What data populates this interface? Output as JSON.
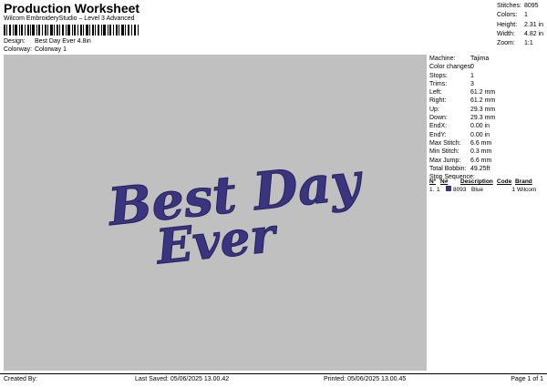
{
  "header": {
    "title": "Production Worksheet",
    "subtitle": "Wilcom EmbroideryStudio – Level 3 Advanced",
    "design_label": "Design:",
    "design_value": "Best Day Ever 4.8in",
    "colorway_label": "Colorway:",
    "colorway_value": "Colorway 1"
  },
  "stats": [
    {
      "label": "Stitches:",
      "value": "8095"
    },
    {
      "label": "Colors:",
      "value": "1"
    },
    {
      "label": "Height:",
      "value": "2.31 in"
    },
    {
      "label": "Width:",
      "value": "4.82 in"
    },
    {
      "label": "Zoom:",
      "value": "1:1"
    }
  ],
  "canvas": {
    "design_text_line1": "Best Day",
    "design_text_line2": "Ever",
    "thread_color": "#3b3580",
    "background": "#c0c0c0"
  },
  "machine": [
    {
      "label": "Machine:",
      "value": "Tajima"
    },
    {
      "label": "Color changes:",
      "value": "0"
    },
    {
      "label": "Stops:",
      "value": "1"
    },
    {
      "label": "Trims:",
      "value": "3"
    },
    {
      "label": "Left:",
      "value": "61.2 mm"
    },
    {
      "label": "Right:",
      "value": "61.2 mm"
    },
    {
      "label": "Up:",
      "value": "29.3 mm"
    },
    {
      "label": "Down:",
      "value": "29.3 mm"
    },
    {
      "label": "EndX:",
      "value": "0.00 in"
    },
    {
      "label": "EndY:",
      "value": "0.00 in"
    },
    {
      "label": "Max Stitch:",
      "value": "6.6 mm"
    },
    {
      "label": "Min Stitch:",
      "value": "0.3 mm"
    },
    {
      "label": "Max Jump:",
      "value": "6.6 mm"
    },
    {
      "label": "Total Bobbin:",
      "value": "49.25ft"
    }
  ],
  "stop_sequence": {
    "title": "Stop Sequence:",
    "headers": [
      "Nº",
      "N#",
      "Description",
      "Code",
      "Brand"
    ],
    "rows": [
      {
        "no": "1.",
        "n": "1",
        "stitches": "8093",
        "description": "Blue",
        "code": "1",
        "brand": "Wilcom",
        "color": "#3b3580"
      }
    ]
  },
  "footer": {
    "created_by": "Created By:",
    "last_saved": "Last Saved: 05/06/2025 13.00.42",
    "printed": "Printed: 05/06/2025 13.00.45",
    "page": "Page 1 of 1"
  }
}
